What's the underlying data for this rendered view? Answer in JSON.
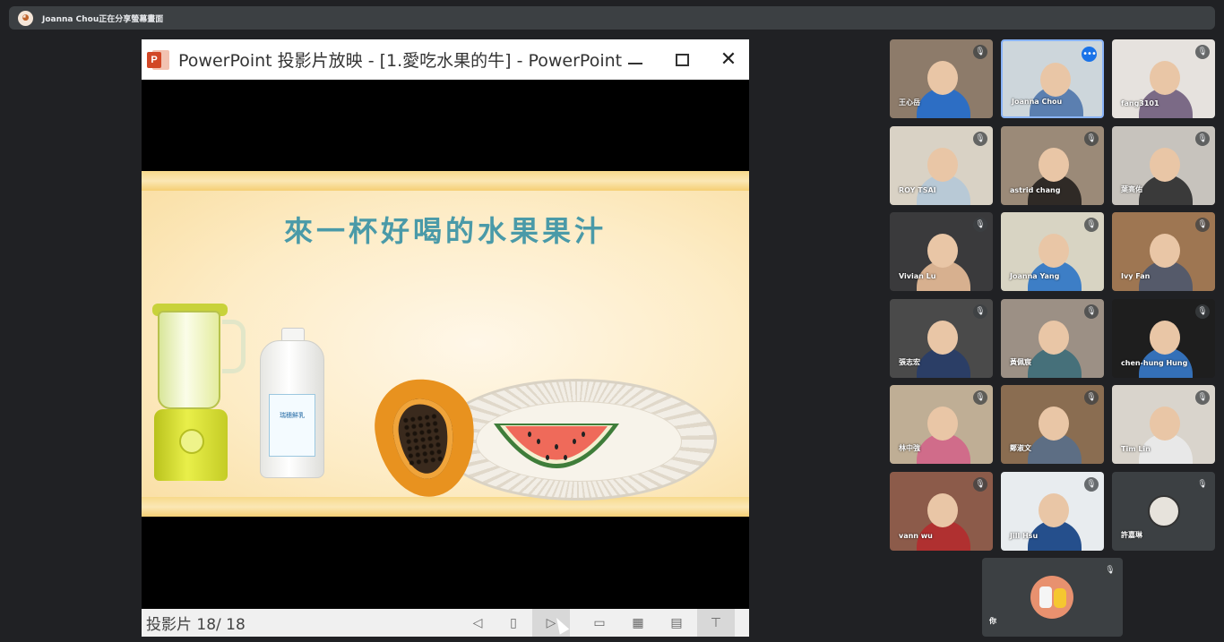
{
  "banner": {
    "text": "Joanna Chou正在分享螢幕畫面",
    "avatar_icon": "presenter-avatar-icon"
  },
  "ppt": {
    "window_title": "PowerPoint 投影片放映 - [1.愛吃水果的牛] - PowerPoint",
    "slide_title": "來一杯好喝的水果果汁",
    "milk_label": "瑞穗鮮乳",
    "status_text": "投影片 18/ 18",
    "icons": [
      "prev-slide-icon",
      "notes-icon",
      "next-slide-icon",
      "normal-view-icon",
      "slide-sorter-icon",
      "reading-view-icon",
      "slideshow-icon"
    ]
  },
  "participants": [
    {
      "name": "王心岳",
      "muted": true
    },
    {
      "name": "Joanna Chou",
      "muted": false,
      "more_menu": true
    },
    {
      "name": "fang3101",
      "muted": true
    },
    {
      "name": "ROY TSAI",
      "muted": true
    },
    {
      "name": "astrid chang",
      "muted": true
    },
    {
      "name": "葉高佑",
      "muted": true
    },
    {
      "name": "Vivian Lu",
      "muted": true
    },
    {
      "name": "Joanna Yang",
      "muted": true
    },
    {
      "name": "Ivy Fan",
      "muted": true
    },
    {
      "name": "張志宏",
      "muted": true
    },
    {
      "name": "黃佩宸",
      "muted": true
    },
    {
      "name": "chen-hung Hung",
      "muted": true
    },
    {
      "name": "林中強",
      "muted": true
    },
    {
      "name": "鄭淑文",
      "muted": true
    },
    {
      "name": "Tim Lin",
      "muted": true
    },
    {
      "name": "vann wu",
      "muted": true
    },
    {
      "name": "Jill Hsu",
      "muted": true
    },
    {
      "name": "許嘉琳",
      "muted": true
    }
  ],
  "self": {
    "name": "你",
    "muted": true
  },
  "colors": {
    "background": "#202124",
    "tile": "#3c4043",
    "accent": "#8ab4f8",
    "ppt_red": "#d24726",
    "slide_title": "#4a9aa8"
  }
}
